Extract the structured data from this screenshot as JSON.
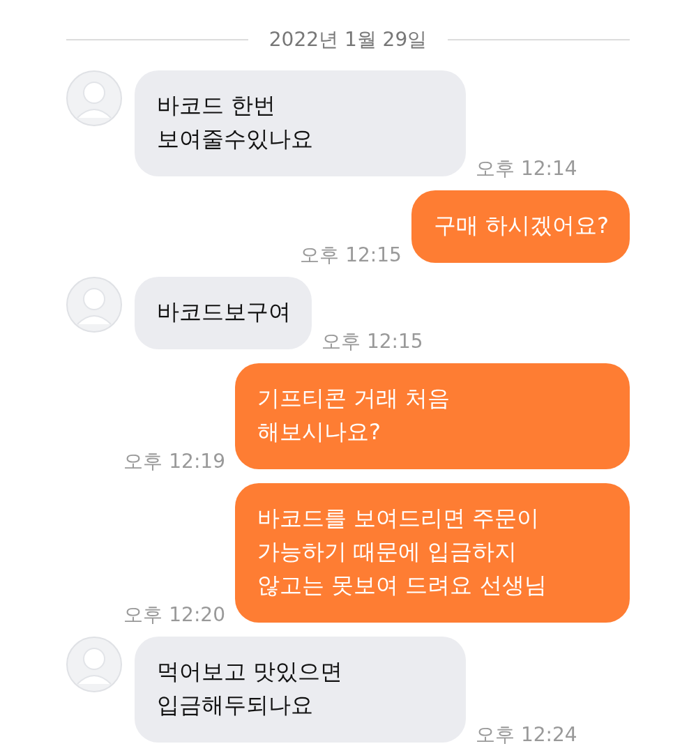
{
  "date_divider": "2022년 1월 29일",
  "messages": [
    {
      "kind": "received",
      "text": "바코드 한번\n보여줄수있나요",
      "time": "오후 12:14"
    },
    {
      "kind": "sent",
      "text": "구매 하시겠어요?",
      "time": "오후 12:15"
    },
    {
      "kind": "received",
      "text": "바코드보구여",
      "time": "오후 12:15"
    },
    {
      "kind": "sent",
      "text": "기프티콘 거래 처음\n해보시나요?",
      "time": "오후 12:19"
    },
    {
      "kind": "sent",
      "text": "바코드를 보여드리면 주문이\n가능하기 때문에 입금하지\n않고는 못보여 드려요 선생님",
      "time": "오후 12:20"
    },
    {
      "kind": "received",
      "text": "먹어보고 맛있으면\n입금해두되나요",
      "time": "오후 12:24"
    }
  ]
}
